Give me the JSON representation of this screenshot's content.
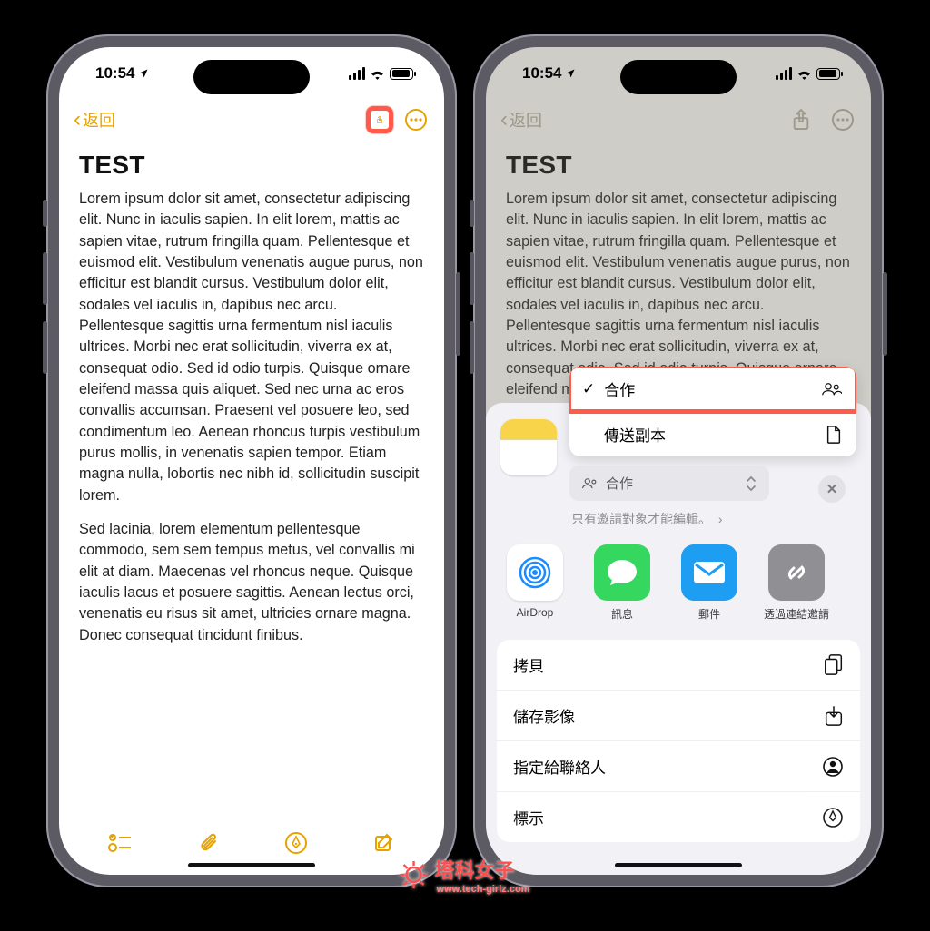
{
  "status": {
    "time": "10:54"
  },
  "nav": {
    "back": "返回"
  },
  "note": {
    "title": "TEST",
    "para1": "Lorem ipsum dolor sit amet, consectetur adipiscing elit. Nunc in iaculis sapien. In elit lorem, mattis ac sapien vitae, rutrum fringilla quam. Pellentesque et euismod elit. Vestibulum venenatis augue purus, non efficitur est blandit cursus. Vestibulum dolor elit, sodales vel iaculis in, dapibus nec arcu. Pellentesque sagittis urna fermentum nisl iaculis ultrices. Morbi nec erat sollicitudin, viverra ex at, consequat odio. Sed id odio turpis. Quisque ornare eleifend massa quis aliquet. Sed nec urna ac eros convallis accumsan. Praesent vel posuere leo, sed condimentum leo. Aenean rhoncus turpis vestibulum purus mollis, in venenatis sapien tempor. Etiam magna nulla, lobortis nec nibh id, sollicitudin suscipit lorem.",
    "para2": "Sed lacinia, lorem elementum pellentesque commodo, sem sem tempus metus, vel convallis mi elit at diam. Maecenas vel rhoncus neque. Quisque iaculis lacus et posuere sagittis. Aenean lectus orci, venenatis eu risus sit amet, ultricies ornare magna. Donec consequat tincidunt finibus."
  },
  "share_menu": {
    "collaborate": "合作",
    "send_copy": "傳送副本",
    "dropdown": "合作",
    "hint": "只有邀請對象才能編輯。"
  },
  "apps": {
    "airdrop": "AirDrop",
    "messages": "訊息",
    "mail": "郵件",
    "link": "透過連結邀請"
  },
  "actions": {
    "copy": "拷貝",
    "save_image": "儲存影像",
    "assign_contact": "指定給聯絡人",
    "markup": "標示"
  },
  "watermark": {
    "brand": "塔科女子",
    "url": "www.tech-girlz.com"
  }
}
